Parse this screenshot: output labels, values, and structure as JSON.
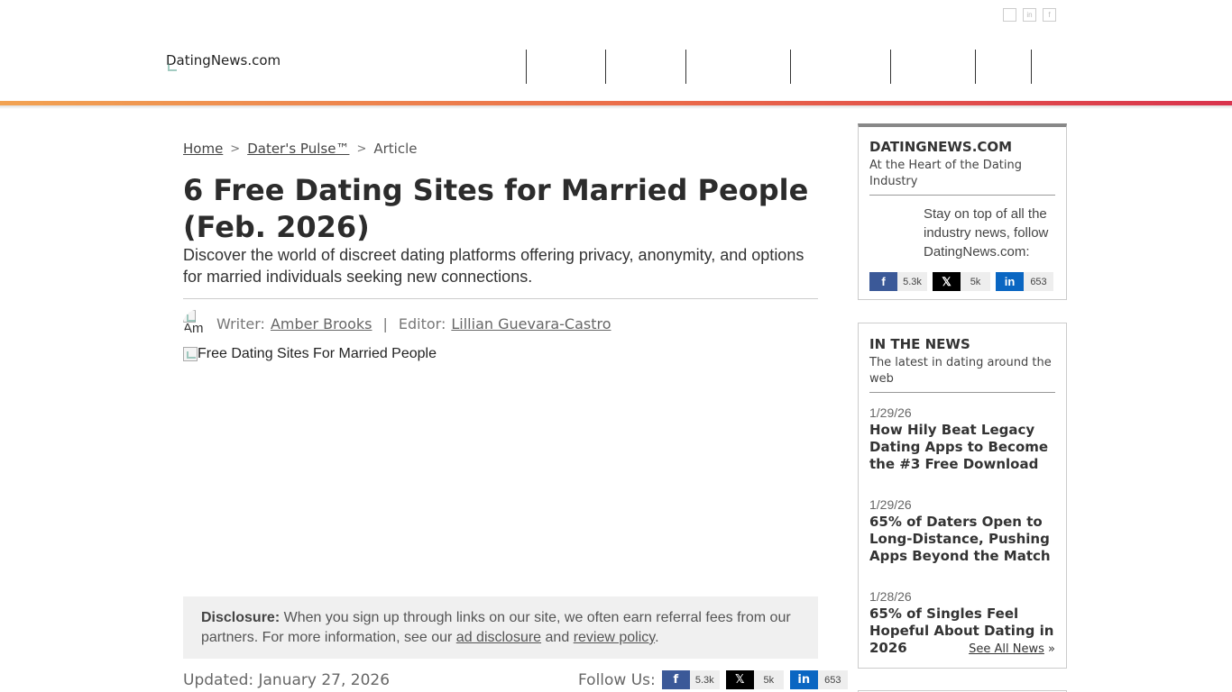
{
  "header": {
    "logo_alt": "DatingNews.com",
    "top_icons": [
      "in",
      "in",
      "f"
    ]
  },
  "breadcrumb": {
    "home": "Home",
    "sep1": ">",
    "section": "Dater's Pulse™",
    "sep2": ">",
    "current": "Article"
  },
  "article": {
    "title": "6 Free Dating Sites for Married People (Feb. 2026)",
    "subtitle": "Discover the world of discreet dating platforms offering privacy, anonymity, and options for married individuals seeking new connections.",
    "writer_label": "Writer:",
    "writer": "Amber Brooks",
    "byline_sep": "|",
    "editor_label": "Editor:",
    "editor": "Lillian Guevara-Castro",
    "avatar_alt": "Am",
    "hero_alt": "Free Dating Sites For Married People",
    "updated": "Updated: January 27, 2026",
    "follow_label": "Follow Us:"
  },
  "disclosure": {
    "label": "Disclosure:",
    "text1": "When you sign up through links on our site, we often earn referral fees from our partners. For more information, see our",
    "link1": "ad disclosure",
    "and": "and",
    "link2": "review policy",
    "end": "."
  },
  "social": {
    "facebook": {
      "icon": "f",
      "count": "5.3k"
    },
    "twitter": {
      "icon": "𝕏",
      "count": "5k"
    },
    "linkedin": {
      "icon": "in",
      "count": "653"
    }
  },
  "sidebar": {
    "brand_box": {
      "title": "DATINGNEWS.COM",
      "subtitle": "At the Heart of the Dating Industry",
      "text": "Stay on top of all the industry news, follow DatingNews.com:"
    },
    "news_box": {
      "title": "IN THE NEWS",
      "subtitle": "The latest in dating around the web",
      "items": [
        {
          "date": "1/29/26",
          "title": "How Hily Beat Legacy Dating Apps to Become the #3 Free Download"
        },
        {
          "date": "1/29/26",
          "title": "65% of Daters Open to Long-Distance, Pushing Apps Beyond the Match"
        },
        {
          "date": "1/28/26",
          "title": "65% of Singles Feel Hopeful About Dating in 2026"
        }
      ],
      "see_all": "See All News",
      "see_all_arrow": "»"
    }
  },
  "colors": {
    "facebook": "#3b5998",
    "twitter": "#000000",
    "linkedin": "#0a66c2",
    "accent_gradient_start": "#f2a353",
    "accent_gradient_end": "#d9334d"
  }
}
